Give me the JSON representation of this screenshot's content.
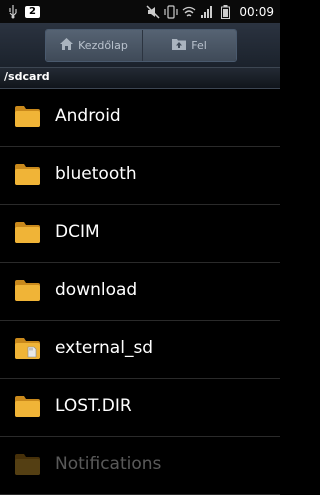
{
  "status_bar": {
    "notification_count": "2",
    "time": "00:09",
    "icons": [
      "usb-icon",
      "mute-icon",
      "vibrate-icon",
      "wifi-icon",
      "signal-icon",
      "battery-icon"
    ]
  },
  "toolbar": {
    "home_label": "Kezdőlap",
    "up_label": "Fel",
    "home_icon": "home-icon",
    "up_icon": "folder-up-icon"
  },
  "path": "/sdcard",
  "colors": {
    "folder": "#f0b437",
    "folder_dark": "#c9891c",
    "background": "#000000",
    "toolbar": "#2b3340"
  },
  "items": [
    {
      "name": "Android",
      "icon": "folder-icon"
    },
    {
      "name": "bluetooth",
      "icon": "folder-icon"
    },
    {
      "name": "DCIM",
      "icon": "folder-icon"
    },
    {
      "name": "download",
      "icon": "folder-icon"
    },
    {
      "name": "external_sd",
      "icon": "sd-card-folder-icon"
    },
    {
      "name": "LOST.DIR",
      "icon": "folder-icon"
    },
    {
      "name": "Notifications",
      "icon": "folder-icon"
    }
  ]
}
